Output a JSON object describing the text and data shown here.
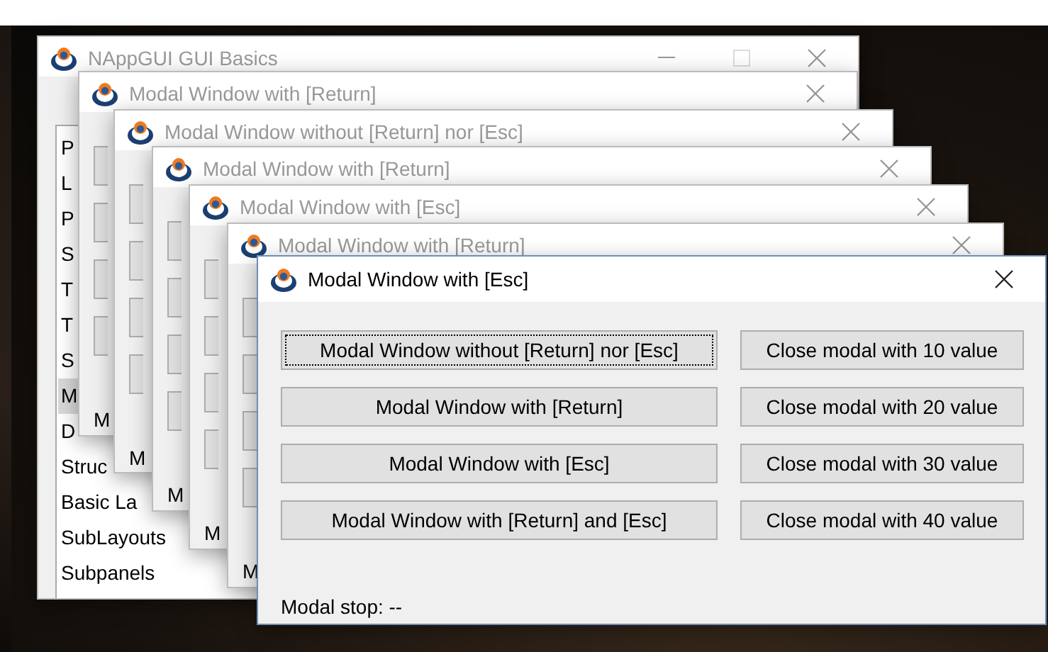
{
  "desktop": {
    "windows": [
      {
        "kind": "main",
        "title": "NAppGUI GUI Basics",
        "maximize_disabled": true,
        "list_items": [
          {
            "label": "P",
            "selected": false
          },
          {
            "label": "L",
            "selected": false
          },
          {
            "label": "P",
            "selected": false
          },
          {
            "label": "S",
            "selected": false
          },
          {
            "label": "T",
            "selected": false
          },
          {
            "label": "T",
            "selected": false
          },
          {
            "label": "S",
            "selected": false
          },
          {
            "label": "M",
            "selected": true
          },
          {
            "label": "D",
            "selected": false
          },
          {
            "label": "Struc",
            "selected": false
          },
          {
            "label": "Basic La",
            "selected": false
          },
          {
            "label": "SubLayouts",
            "selected": false
          },
          {
            "label": "Subpanels",
            "selected": false
          }
        ]
      },
      {
        "kind": "modal",
        "title": "Modal Window with [Return]",
        "status": "M"
      },
      {
        "kind": "modal",
        "title": "Modal Window without [Return] nor [Esc]",
        "status": "M"
      },
      {
        "kind": "modal",
        "title": "Modal Window with [Return]",
        "status": "M"
      },
      {
        "kind": "modal",
        "title": "Modal Window with [Esc]",
        "status": "M"
      },
      {
        "kind": "modal",
        "title": "Modal Window with [Return]",
        "status": "M"
      },
      {
        "kind": "dialog",
        "title": "Modal Window with [Esc]",
        "status": "Modal stop: --",
        "buttons": [
          {
            "label": "Modal Window without [Return] nor [Esc]",
            "focused": true
          },
          {
            "label": "Close modal with 10 value",
            "focused": false
          },
          {
            "label": "Modal Window with [Return]",
            "focused": false
          },
          {
            "label": "Close modal with 20 value",
            "focused": false
          },
          {
            "label": "Modal Window with [Esc]",
            "focused": false
          },
          {
            "label": "Close modal with 30 value",
            "focused": false
          },
          {
            "label": "Modal Window with [Return] and [Esc]",
            "focused": false
          },
          {
            "label": "Close modal with 40 value",
            "focused": false
          }
        ]
      }
    ]
  }
}
